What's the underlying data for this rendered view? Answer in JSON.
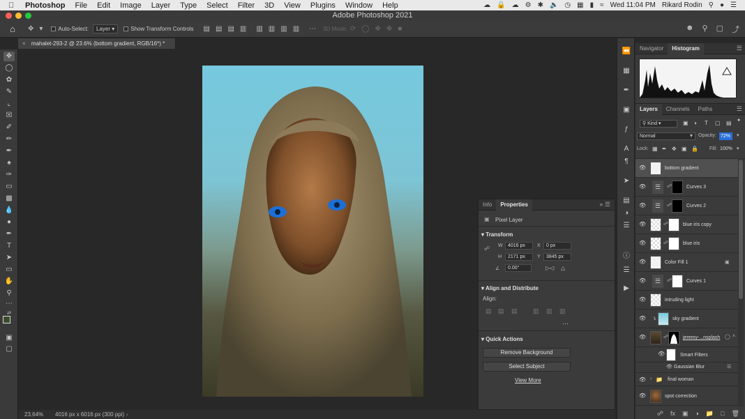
{
  "menubar": {
    "app_name": "Photoshop",
    "items": [
      "File",
      "Edit",
      "Image",
      "Layer",
      "Type",
      "Select",
      "Filter",
      "3D",
      "View",
      "Plugins",
      "Window",
      "Help"
    ],
    "clock": "Wed 11:04 PM",
    "user": "Rikard Rodin",
    "status_icons": [
      "creative-cloud-icon",
      "lock-icon",
      "cloud-icon",
      "settings-icon",
      "bluetooth-icon",
      "sound-icon",
      "time-machine-icon",
      "grid-icon",
      "battery-icon",
      "wifi-icon",
      "search-icon",
      "user-icon",
      "list-icon"
    ]
  },
  "window": {
    "title": "Adobe Photoshop 2021"
  },
  "options_bar": {
    "auto_select_label": "Auto-Select:",
    "auto_select_value": "Layer",
    "show_transform_label": "Show Transform Controls",
    "mode_label": "3D Mode:"
  },
  "document": {
    "tab_title": "mahalet-293-2 @ 23.6% (bottom gradient, RGB/16*) *",
    "zoom": "23.64%",
    "dimensions": "4016 px x 6016 px (300 ppi)"
  },
  "properties": {
    "tabs": [
      "Info",
      "Properties"
    ],
    "active_tab": "Properties",
    "layer_type": "Pixel Layer",
    "transform": {
      "title": "Transform",
      "w_label": "W",
      "w": "4016 px",
      "h_label": "H",
      "h": "2171 px",
      "x_label": "X",
      "x": "0 px",
      "y_label": "Y",
      "y": "3845 px",
      "angle": "0.00°"
    },
    "align": {
      "title": "Align and Distribute",
      "label": "Align:"
    },
    "quick_actions": {
      "title": "Quick Actions",
      "remove_bg": "Remove Background",
      "select_subject": "Select Subject",
      "view_more": "View More"
    }
  },
  "right_panel": {
    "top_tabs": [
      "Navigator",
      "Histogram"
    ],
    "top_active": "Histogram",
    "layer_tabs": [
      "Layers",
      "Channels",
      "Paths"
    ],
    "layer_active": "Layers",
    "filter_kind": "Kind",
    "blend_mode": "Normal",
    "opacity_label": "Opacity:",
    "opacity": "72%",
    "lock_label": "Lock:",
    "fill_label": "Fill:",
    "fill": "100%",
    "layers": [
      {
        "name": "bottom gradient",
        "selected": true,
        "thumb": "white",
        "mask": false
      },
      {
        "name": "Curves 3",
        "selected": false,
        "thumb": "curves",
        "mask": "black"
      },
      {
        "name": "Curves 2",
        "selected": false,
        "thumb": "curves",
        "mask": "black"
      },
      {
        "name": "blue iris copy",
        "selected": false,
        "thumb": "checker",
        "mask": "white-dot"
      },
      {
        "name": "blue iris",
        "selected": false,
        "thumb": "checker",
        "mask": "white-dot"
      },
      {
        "name": "Color Fill 1",
        "selected": false,
        "thumb": "white",
        "mask": false
      },
      {
        "name": "Curves 1",
        "selected": false,
        "thumb": "curves",
        "mask": "white"
      },
      {
        "name": "intruding light",
        "selected": false,
        "thumb": "checker",
        "mask": false
      },
      {
        "name": "sky gradient",
        "selected": false,
        "thumb": "sky",
        "mask": false
      },
      {
        "name": "jeremy-...nsplash",
        "selected": false,
        "thumb": "photo",
        "mask": "silhouette"
      }
    ],
    "smart_filters_label": "Smart Filters",
    "gaussian_blur_label": "Gaussian Blur",
    "group_name": "final woman",
    "last_layer": "spot correction"
  }
}
